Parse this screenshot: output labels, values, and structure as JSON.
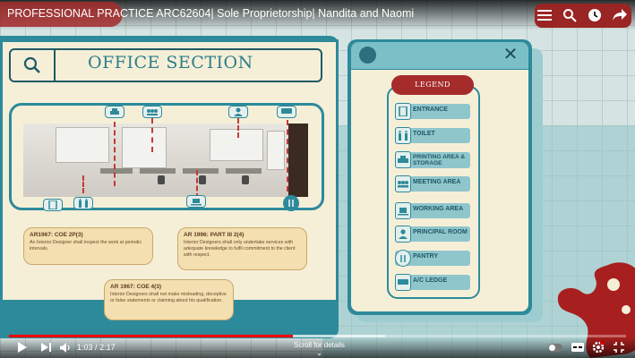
{
  "video": {
    "title": "PROFESSIONAL PRACTICE ARC62604| Sole Proprietorship| Nandita and Naomi",
    "time_current": "1:03",
    "time_separator": "/",
    "time_total": "2:17",
    "progress_fraction": 0.46,
    "loaded_fraction": 0.61,
    "scroll_hint": "Scroll for details"
  },
  "slide": {
    "heading": "OFFICE SECTION",
    "rules": [
      {
        "head": "AR1967: COE 2P(3)",
        "text": "An Interior Designer shall inspect the work at periodic intervals."
      },
      {
        "head": "AR 1996: PART III 2(4)",
        "text": "Interior Designers shall only undertake services with adequate knowledge to fulfil commitment to the client with respect."
      },
      {
        "head": "AR 1967: COE 4(3)",
        "text": "Interior Designers shall not make misleading, deceptive or false statements or claiming about his qualification."
      }
    ],
    "legend": {
      "title": "LEGEND",
      "items": [
        {
          "label": "ENTRANCE",
          "icon": "entrance-icon"
        },
        {
          "label": "TOILET",
          "icon": "toilet-icon"
        },
        {
          "label": "PRINTING AREA & STORAGE",
          "icon": "printer-icon"
        },
        {
          "label": "MEETING AREA",
          "icon": "meeting-icon"
        },
        {
          "label": "WORKING AREA",
          "icon": "laptop-icon"
        },
        {
          "label": "PRINCIPAL ROOM",
          "icon": "person-icon"
        },
        {
          "label": "PANTRY",
          "icon": "pantry-icon"
        },
        {
          "label": "A/C LEDGE",
          "icon": "ac-icon"
        }
      ]
    }
  },
  "colors": {
    "teal": "#2d8a9b",
    "cream": "#f6efd8",
    "legend_red": "#a62b2b",
    "progress_red": "#ff0000"
  }
}
